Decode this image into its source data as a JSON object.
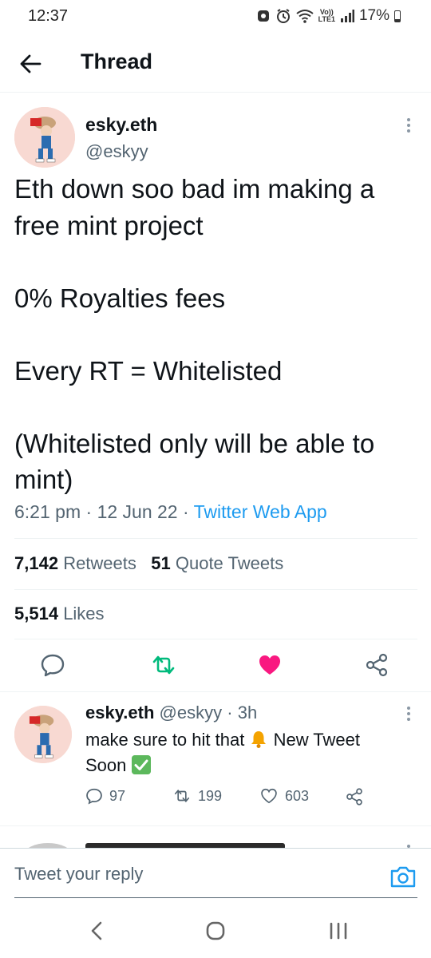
{
  "status_bar": {
    "time": "12:37",
    "battery": "17%",
    "network": "LTE1",
    "network_top": "Vo))"
  },
  "header": {
    "title": "Thread",
    "back_icon": "arrow-left-icon"
  },
  "main_tweet": {
    "name": "esky.eth",
    "handle": "@eskyy",
    "text": "Eth down soo bad im making a free mint project\n\n0% Royalties fees\n\nEvery RT = Whitelisted\n\n(Whitelisted only will be able to mint)",
    "time": "6:21 pm",
    "date": "12 Jun 22",
    "source": "Twitter Web App",
    "retweets": "7,142",
    "retweets_label": "Retweets",
    "quote_tweets": "51",
    "quote_tweets_label": "Quote Tweets",
    "likes": "5,514",
    "likes_label": "Likes",
    "liked": true
  },
  "reply_tweet": {
    "name": "esky.eth",
    "handle": "@eskyy",
    "age": "3h",
    "text_before": "make sure to hit that",
    "text_after": "New Tweet Soon",
    "replies": "97",
    "retweets": "199",
    "likes": "603"
  },
  "reply_bar": {
    "placeholder": "Tweet your reply"
  },
  "colors": {
    "accent": "#1d9bf0",
    "retweet_green": "#00ba7c",
    "like_pink": "#f91880",
    "muted": "#536471"
  }
}
